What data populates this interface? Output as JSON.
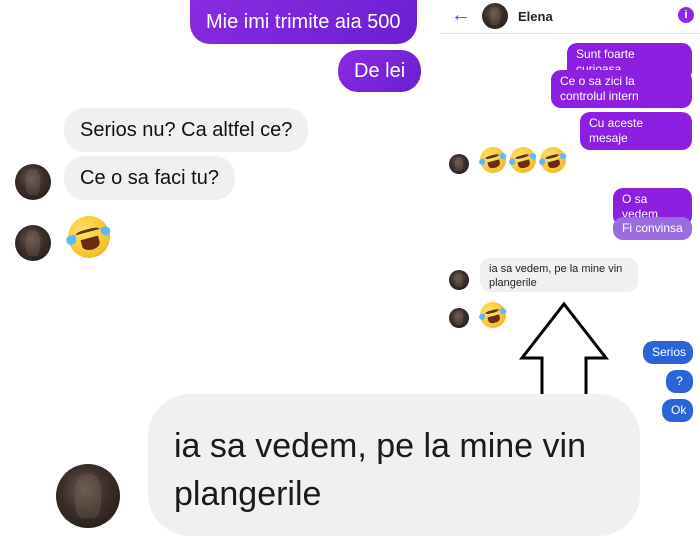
{
  "left_chat": {
    "sent": [
      {
        "text": "Mie imi trimite aia 500"
      },
      {
        "text": "De lei"
      }
    ],
    "received": [
      {
        "text": "Serios nu? Ca altfel ce?"
      },
      {
        "text": "Ce o sa faci tu?"
      }
    ]
  },
  "right_chat": {
    "header": {
      "contact_name": "Elena",
      "info_icon": "i"
    },
    "sent_purple": [
      {
        "text": "Sunt foarte curioasa"
      },
      {
        "text": "Ce o sa zici la controlul intern"
      },
      {
        "text": "Cu aceste mesaje"
      }
    ],
    "sent_purple_2": [
      {
        "text": "O sa vedem"
      },
      {
        "text": "Fi convinsa"
      }
    ],
    "received": {
      "text": "ia sa vedem, pe la mine vin plangerile"
    },
    "sent_blue": [
      {
        "text": "Serios"
      },
      {
        "text": "?"
      },
      {
        "text": "Ok"
      }
    ]
  },
  "zoom": {
    "text": "ia sa vedem, pe la mine vin plangerile"
  },
  "colors": {
    "purple": "#7b2ff0",
    "blue": "#2c64d8",
    "incoming_bg": "#f0f0f0"
  }
}
